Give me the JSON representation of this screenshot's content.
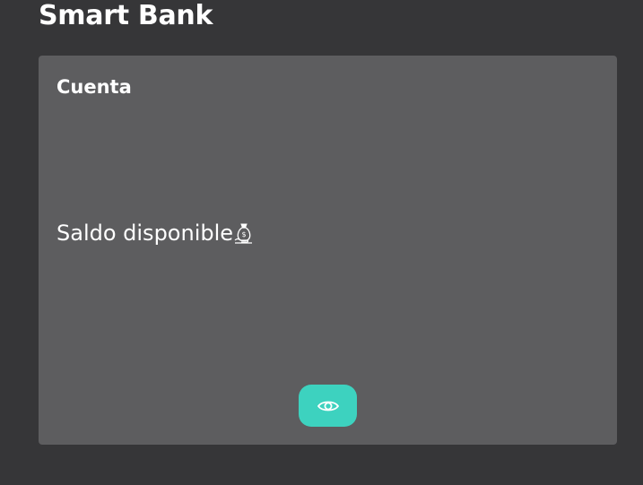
{
  "app": {
    "title": "Smart Bank"
  },
  "card": {
    "title": "Cuenta",
    "balance_label": "Saldo disponible",
    "balance_icon": "money-bag-icon",
    "toggle_icon": "eye-icon"
  },
  "colors": {
    "background": "#363638",
    "card": "#5d5d5f",
    "accent": "#3dd2bf",
    "text": "#ffffff"
  }
}
